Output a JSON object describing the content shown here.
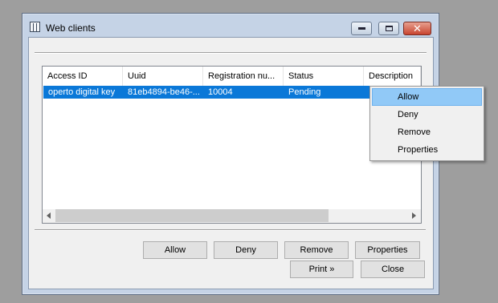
{
  "window": {
    "title": "Web clients",
    "title_icon": "table-icon",
    "controls": {
      "minimize": "minimize-icon",
      "maximize": "maximize-icon",
      "close": "close-icon"
    }
  },
  "list": {
    "columns": [
      "Access ID",
      "Uuid",
      "Registration nu...",
      "Status",
      "Description"
    ],
    "rows": [
      {
        "access_id": "operto digital key",
        "uuid": "81eb4894-be46-...",
        "registration": "10004",
        "status": "Pending",
        "description": "",
        "selected": true
      }
    ]
  },
  "actions": {
    "allow": "Allow",
    "deny": "Deny",
    "remove": "Remove",
    "properties": "Properties"
  },
  "footer": {
    "print": "Print »",
    "close": "Close"
  },
  "context_menu": {
    "items": [
      "Allow",
      "Deny",
      "Remove",
      "Properties"
    ],
    "highlighted_index": 0
  },
  "colors": {
    "selection": "#0a78d8",
    "menu_highlight": "#91c9f7",
    "close_button": "#c8442f"
  }
}
